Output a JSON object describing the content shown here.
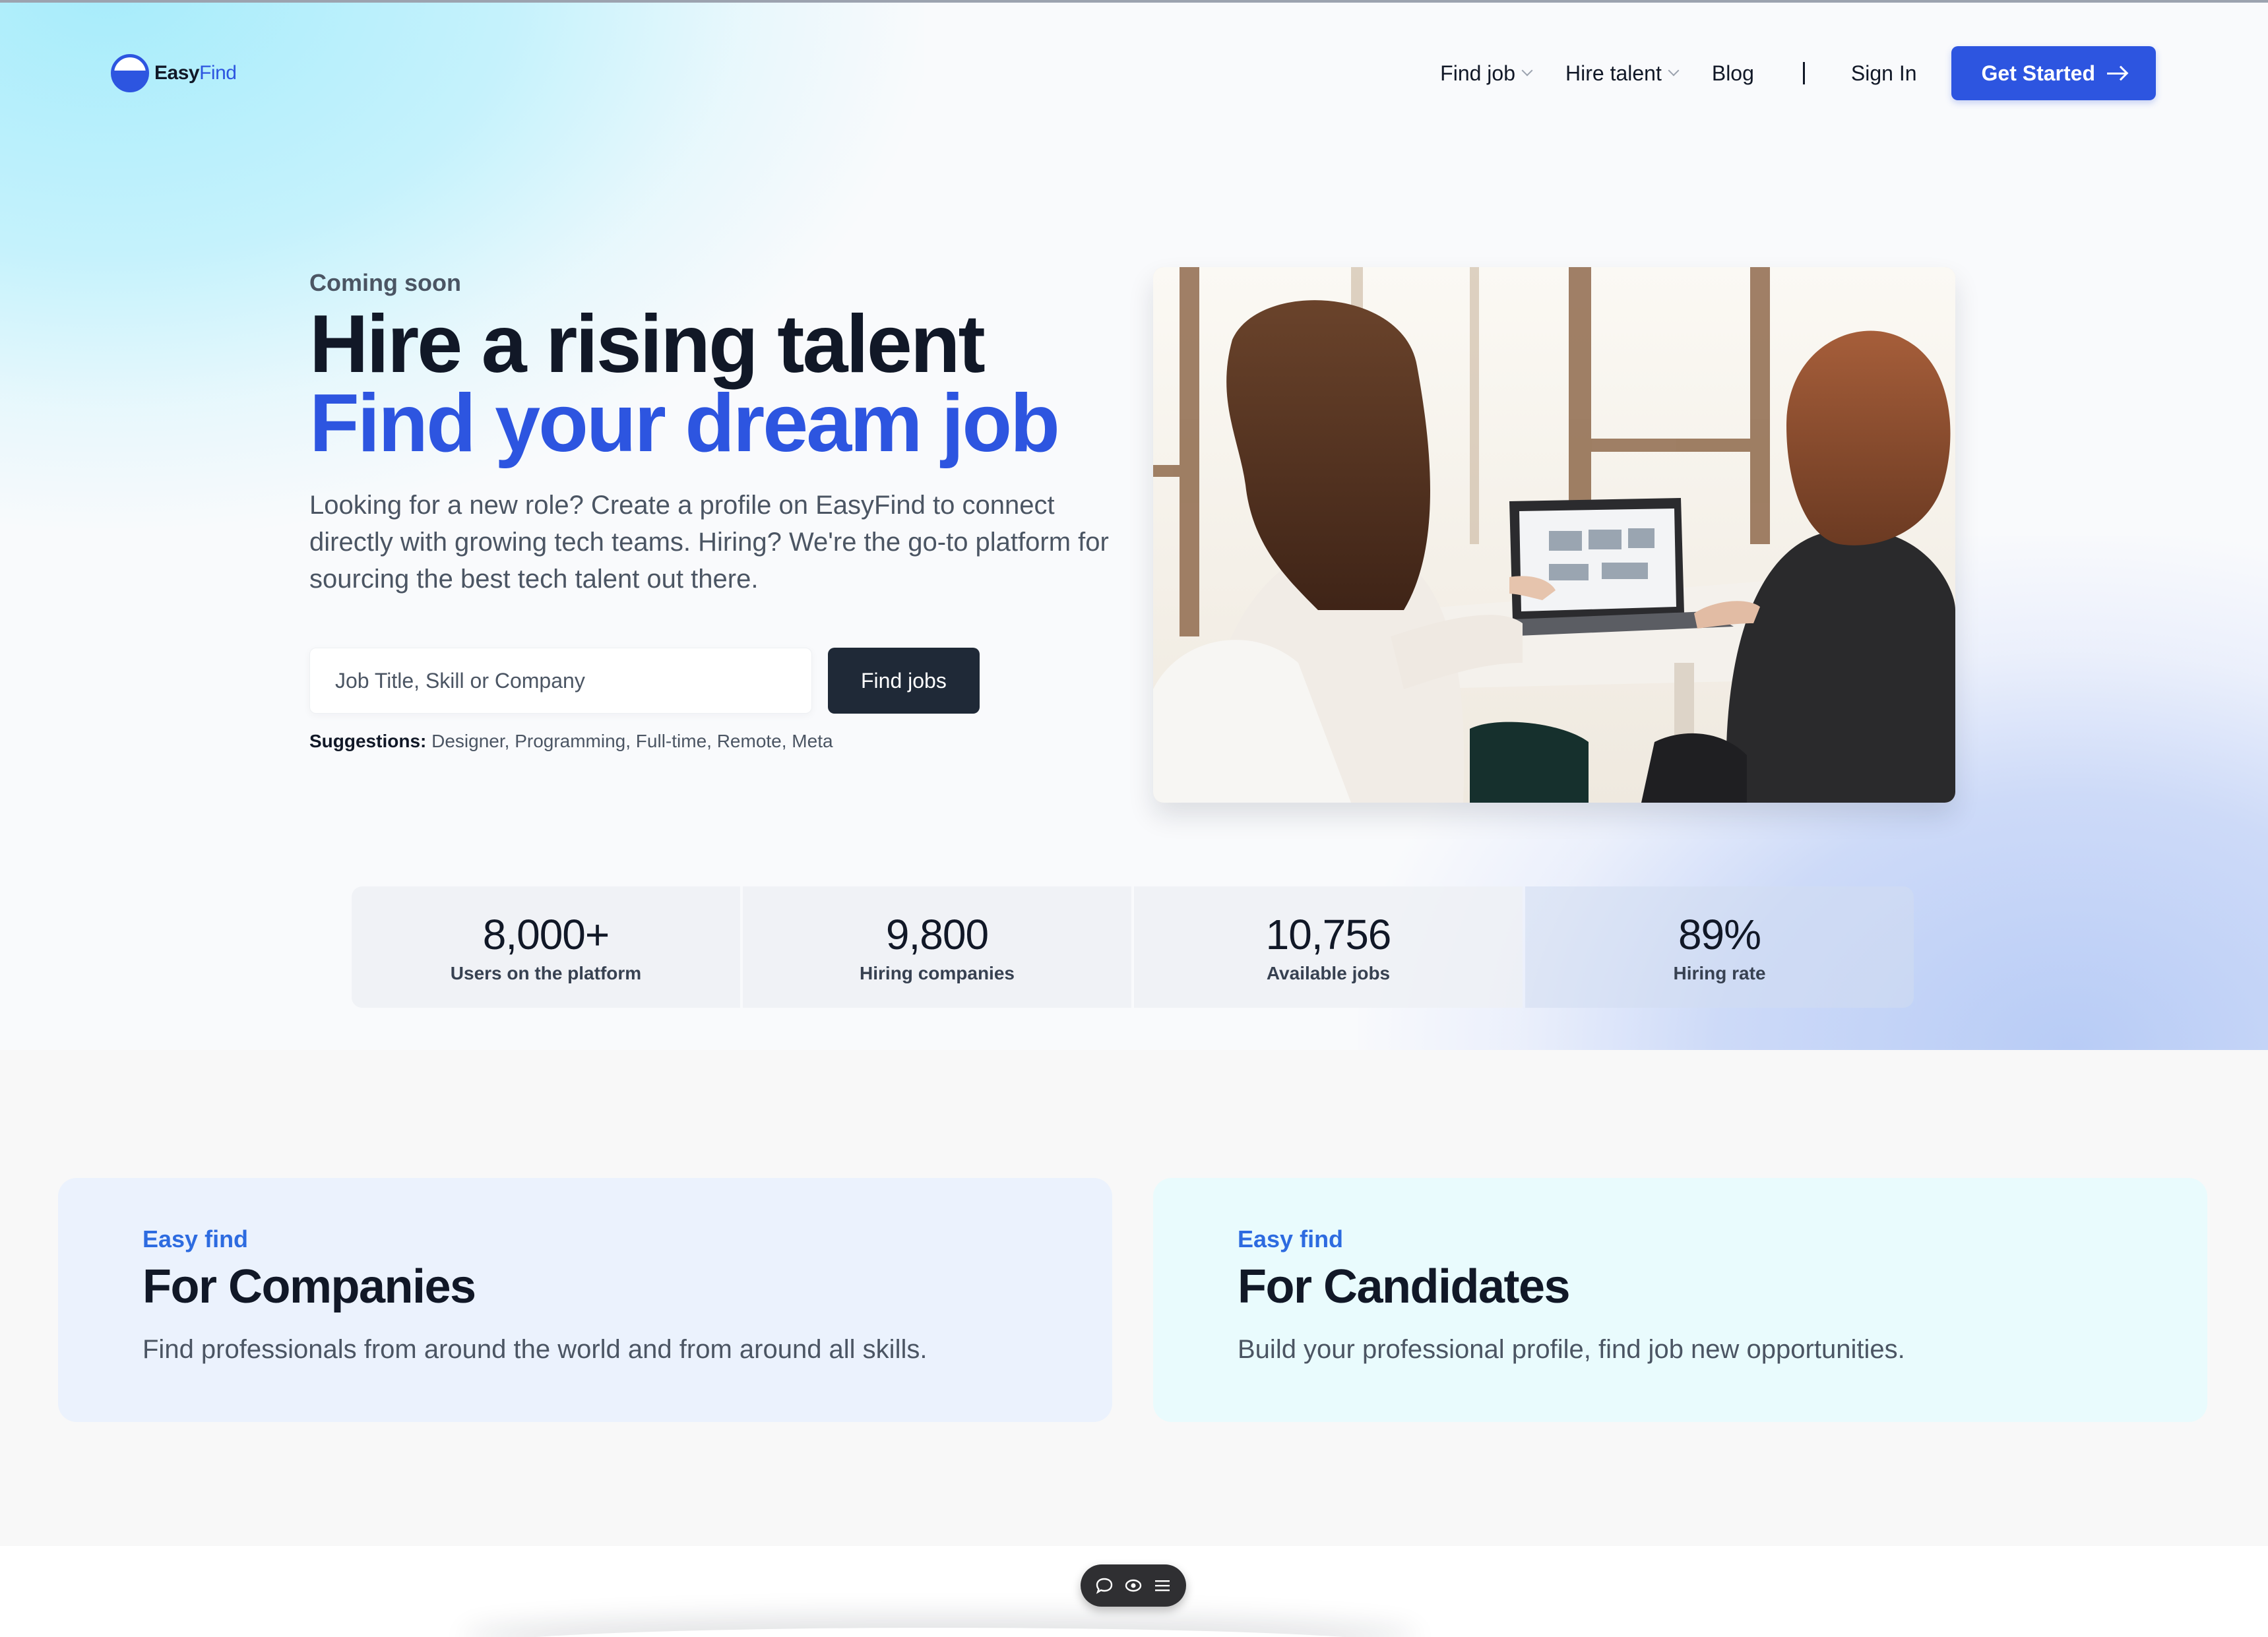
{
  "brand": {
    "name_part1": "Easy",
    "name_part2": "Find",
    "accent": "#2d55e0"
  },
  "nav": {
    "items": [
      {
        "label": "Find job",
        "dropdown": true
      },
      {
        "label": "Hire talent",
        "dropdown": true
      },
      {
        "label": "Blog",
        "dropdown": false
      }
    ],
    "separator": "|",
    "sign_in": "Sign In",
    "cta": "Get Started"
  },
  "hero": {
    "eyebrow": "Coming soon",
    "headline_line1": "Hire a rising talent",
    "headline_line2": "Find your dream job",
    "lead": "Looking for a new role? Create a profile on EasyFind to connect directly with growing tech teams. Hiring? We're the go-to platform for sourcing the best tech talent out there.",
    "search": {
      "placeholder": "Job Title, Skill or Company",
      "value": "",
      "button": "Find jobs"
    },
    "suggestions": {
      "label": "Suggestions:",
      "items": "Designer, Programming, Full-time, Remote, Meta"
    },
    "photo_icon": "two-women-with-laptop-photo"
  },
  "stats": [
    {
      "value": "8,000+",
      "label": "Users on the platform"
    },
    {
      "value": "9,800",
      "label": "Hiring companies"
    },
    {
      "value": "10,756",
      "label": "Available jobs"
    },
    {
      "value": "89%",
      "label": "Hiring rate"
    }
  ],
  "cards": {
    "companies": {
      "eyebrow": "Easy find",
      "title": "For Companies",
      "text": "Find professionals from around the world and from around all skills."
    },
    "candidates": {
      "eyebrow": "Easy find",
      "title": "For Candidates",
      "text": "Build your professional profile, find job new opportunities."
    }
  },
  "toolbar": {
    "icons": [
      "comment-icon",
      "eye-icon",
      "menu-icon"
    ]
  }
}
